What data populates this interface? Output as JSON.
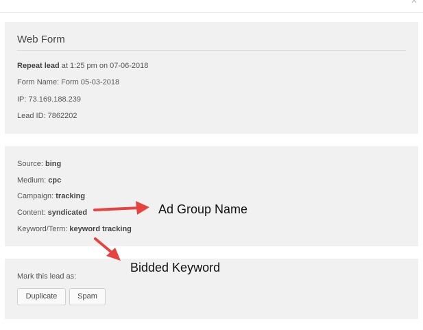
{
  "web_form": {
    "title": "Web Form",
    "repeat_label": "Repeat lead",
    "repeat_rest": " at 1:25 pm on 07-06-2018",
    "form_name": "Form Name: Form 05-03-2018",
    "ip": "IP: 73.169.188.239",
    "lead_id": "Lead ID: 7862202"
  },
  "tracking": {
    "source_label": "Source: ",
    "source_value": "bing",
    "medium_label": "Medium: ",
    "medium_value": "cpc",
    "campaign_label": "Campaign: ",
    "campaign_value": "tracking",
    "content_label": "Content: ",
    "content_value": "syndicated",
    "keyword_label": "Keyword/Term: ",
    "keyword_value": "keyword tracking"
  },
  "mark": {
    "prompt": "Mark this lead as:",
    "duplicate_label": "Duplicate",
    "spam_label": "Spam"
  },
  "annotations": {
    "ad_group": "Ad Group Name",
    "bidded_keyword": "Bidded Keyword",
    "arrow_color": "#e8423f"
  }
}
